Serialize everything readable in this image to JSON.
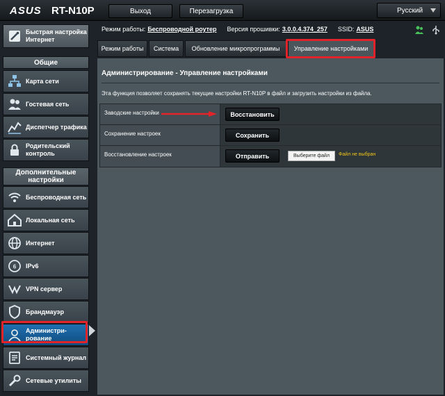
{
  "header": {
    "logo": "ASUS",
    "model": "RT-N10P",
    "logout_label": "Выход",
    "reboot_label": "Перезагрузка",
    "language": "Русский"
  },
  "sidebar": {
    "quick_setup": "Быстрая настройка Интернет",
    "general_header": "Общие",
    "general_items": [
      {
        "label": "Карта сети",
        "icon": "network-map-icon"
      },
      {
        "label": "Гостевая сеть",
        "icon": "guest-network-icon"
      },
      {
        "label": "Диспетчер трафика",
        "icon": "traffic-manager-icon"
      },
      {
        "label": "Родительский контроль",
        "icon": "parental-control-icon"
      }
    ],
    "advanced_header": "Дополнительные настройки",
    "advanced_items": [
      {
        "label": "Беспроводная сеть",
        "icon": "wireless-icon"
      },
      {
        "label": "Локальная сеть",
        "icon": "lan-icon"
      },
      {
        "label": "Интернет",
        "icon": "globe-icon"
      },
      {
        "label": "IPv6",
        "icon": "ipv6-icon"
      },
      {
        "label": "VPN сервер",
        "icon": "vpn-icon"
      },
      {
        "label": "Брандмауэр",
        "icon": "firewall-icon"
      },
      {
        "label": "Администри-рование",
        "icon": "admin-icon"
      },
      {
        "label": "Системный журнал",
        "icon": "system-log-icon"
      },
      {
        "label": "Сетевые утилиты",
        "icon": "network-tools-icon"
      }
    ]
  },
  "info": {
    "mode_label": "Режим работы:",
    "mode_value": "Беспроводной роутер",
    "firmware_label": "Версия прошивки:",
    "firmware_value": "3.0.0.4.374_257",
    "ssid_label": "SSID:",
    "ssid_value": "ASUS"
  },
  "tabs": [
    "Режим работы",
    "Система",
    "Обновление микропрограммы",
    "Управление настройками"
  ],
  "main": {
    "title": "Администрирование - Управление настройками",
    "description": "Эта функция позволяет сохранять текущие настройки RT-N10P в файл и загрузить настройки из файла.",
    "rows": [
      {
        "label": "Заводские настройки",
        "button": "Восстановить"
      },
      {
        "label": "Сохранение настроек",
        "button": "Сохранить"
      },
      {
        "label": "Восстановление настроек",
        "button": "Отправить"
      }
    ],
    "file_button": "Выберите файл",
    "no_file": "Файл не выбран"
  },
  "colors": {
    "highlight": "#e2232a",
    "selected": "#1e6fb0",
    "no_file_text": "#f0c419"
  }
}
